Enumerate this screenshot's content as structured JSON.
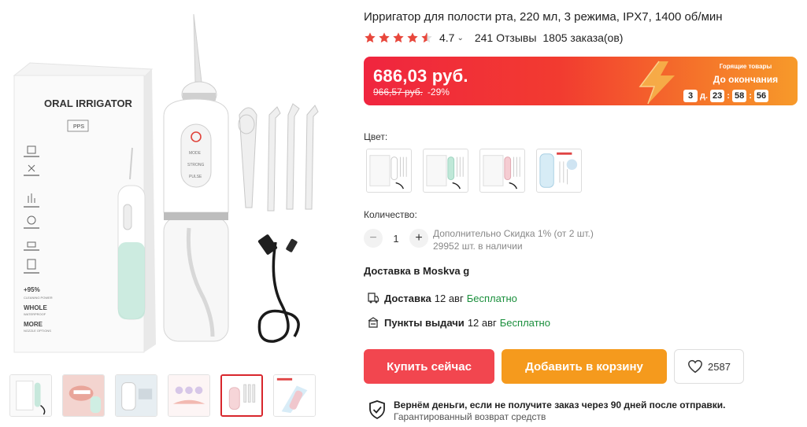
{
  "gallery": {
    "box": {
      "brand_title": "ORAL IRRIGATOR",
      "badge": "PPS",
      "stat_percent": "+95%",
      "stat_label": "CLEANING POWER",
      "feature_1": "WHOLE",
      "feature_1_sub": "WATERPROOF",
      "feature_2": "MORE",
      "feature_2_sub": "NOZZLE OPTIONS"
    },
    "device_buttons": [
      "MODE",
      "STRONG",
      "PULSE"
    ],
    "thumbnails": [
      {
        "name": "thumb-1",
        "active": false
      },
      {
        "name": "thumb-2",
        "active": false
      },
      {
        "name": "thumb-3",
        "active": false
      },
      {
        "name": "thumb-4",
        "active": false
      },
      {
        "name": "thumb-5",
        "active": true
      },
      {
        "name": "thumb-6",
        "active": false
      }
    ]
  },
  "product": {
    "title": "Ирригатор для полости рта, 220 мл, 3 режима, IPX7, 1400 об/мин",
    "rating": "4.7",
    "rating_stars": 4.5,
    "reviews": "241 Отзывы",
    "orders": "1805 заказа(ов)"
  },
  "price": {
    "current": "686,03 руб.",
    "old": "966,57 руб.",
    "discount": "-29%",
    "hot_label": "Горящие товары",
    "until_label": "До окончания",
    "timer": {
      "days": "3",
      "days_unit": "д.",
      "hours": "23",
      "minutes": "58",
      "seconds": "56"
    }
  },
  "colors": {
    "label": "Цвет:",
    "options": [
      "white",
      "mint",
      "pink",
      "blue"
    ]
  },
  "quantity": {
    "label": "Количество:",
    "minus": "−",
    "value": "1",
    "plus": "+",
    "discount_note": "Дополнительно Скидка 1% (от 2 шт.)",
    "stock": "29952 шт. в наличии"
  },
  "delivery": {
    "heading": "Доставка в Moskva g",
    "rows": [
      {
        "label": "Доставка",
        "date": "12 авг",
        "price": "Бесплатно"
      },
      {
        "label": "Пункты выдачи",
        "date": "12 авг",
        "price": "Бесплатно"
      }
    ]
  },
  "actions": {
    "buy_now": "Купить сейчас",
    "add_to_cart": "Добавить в корзину",
    "wishlist_count": "2587"
  },
  "guarantee": {
    "title": "Вернём деньги, если не получите заказ через 90 дней после отправки.",
    "subtitle": "Гарантированный возврат средств"
  },
  "theme": {
    "accent_red": "#f2464f",
    "accent_orange": "#f59a1d",
    "star_color": "#e8473c",
    "free_color": "#1a8f3c"
  }
}
